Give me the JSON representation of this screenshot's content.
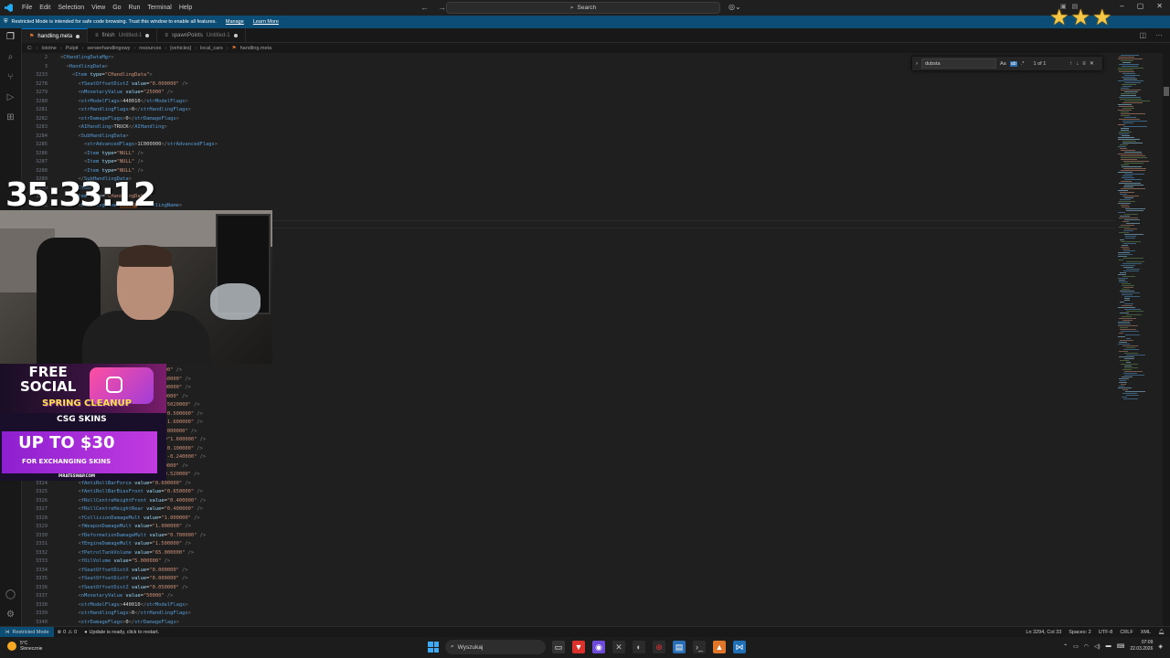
{
  "titlebar": {
    "menu": [
      "File",
      "Edit",
      "Selection",
      "View",
      "Go",
      "Run",
      "Terminal",
      "Help"
    ],
    "search_label": "Search"
  },
  "banner": {
    "message": "Restricted Mode is intended for safe code browsing. Trust this window to enable all features.",
    "manage": "Manage",
    "learn_more": "Learn More"
  },
  "tabs": [
    {
      "label": "handling.meta",
      "desc": "",
      "active": true,
      "dirty": true
    },
    {
      "label": "finish",
      "desc": "Untitled-1",
      "active": false,
      "dirty": true
    },
    {
      "label": "spawnPoints",
      "desc": "Untitled-1",
      "active": false,
      "dirty": true
    }
  ],
  "breadcrumb": [
    "C:",
    "Istotne",
    "Pulpit",
    "serwerhandlingowy",
    "resources",
    "[vehicles]",
    "local_cars",
    "handling.meta"
  ],
  "find": {
    "query": "dubsta",
    "match_case": "Aa",
    "whole_word": "ab",
    "regex": ".*",
    "match_count": "1 of 1"
  },
  "editor_lines": [
    {
      "n": "2",
      "t": "<CHandlingDataMgr>"
    },
    {
      "n": "3",
      "t": "  <HandlingData>"
    },
    {
      "n": "3233",
      "t": "    <Item type=\"CHandlingData\">"
    },
    {
      "n": "3278",
      "t": "      <fSeatOffsetDistZ value=\"0.000000\" />"
    },
    {
      "n": "3279",
      "t": "      <nMonetaryValue value=\"25000\" />"
    },
    {
      "n": "3280",
      "t": "      <strModelFlags>440010</strModelFlags>"
    },
    {
      "n": "3281",
      "t": "      <strHandlingFlags>0</strHandlingFlags>"
    },
    {
      "n": "3282",
      "t": "      <strDamageFlags>0</strDamageFlags>"
    },
    {
      "n": "3283",
      "t": "      <AIHandling>TRUCK</AIHandling>"
    },
    {
      "n": "3284",
      "t": "      <SubHandlingData>"
    },
    {
      "n": "3285",
      "t": "        <strAdvancedFlags>1C000000</strAdvancedFlags>"
    },
    {
      "n": "3286",
      "t": "        <Item type=\"NULL\" />"
    },
    {
      "n": "3287",
      "t": "        <Item type=\"NULL\" />"
    },
    {
      "n": "3288",
      "t": "        <Item type=\"NULL\" />"
    },
    {
      "n": "3289",
      "t": "      </SubHandlingData>"
    },
    {
      "n": "3290",
      "t": "    </Item>"
    },
    {
      "n": "3291",
      "t": "    <Item type=\"CHandlingData\">"
    },
    {
      "n": "3292",
      "t": "      <handlingName>DUBSTA</handlingName>"
    },
    {
      "n": "3293",
      "t": ""
    },
    {
      "n": "3294",
      "t": ""
    },
    {
      "n": "3295",
      "t": "      <fInitialDragCoeff value=\"8.150000\" />"
    },
    {
      "n": "3296",
      "t": "      <fPercentSubmerged value=\"85.000000\" />"
    },
    {
      "n": "3297",
      "t": ""
    },
    {
      "n": "3298",
      "t": ""
    },
    {
      "n": "3299",
      "t": ""
    },
    {
      "n": "3300",
      "t": ""
    },
    {
      "n": "3301",
      "t": ""
    },
    {
      "n": "3302",
      "t": ""
    },
    {
      "n": "3303",
      "t": ""
    },
    {
      "n": "3304",
      "t": ""
    },
    {
      "n": "3305",
      "t": ""
    },
    {
      "n": "3306",
      "t": ""
    },
    {
      "n": "3307",
      "t": ""
    },
    {
      "n": "3308",
      "t": ""
    },
    {
      "n": "3309",
      "t": ""
    },
    {
      "n": "3310",
      "t": ""
    },
    {
      "n": "3311",
      "t": "      <fSteeringLock value=\"25.500000\" />"
    },
    {
      "n": "3312",
      "t": "      <fTractionCurveMin value=\"0.150000\" />"
    },
    {
      "n": "3313",
      "t": "      <fTractionLossMult value=\"1.300000\" />"
    },
    {
      "n": "3314",
      "t": "      <fSuspensionForce value=\"0.000000\" />"
    },
    {
      "n": "3315",
      "t": "      <fSuspensionCompDamp value=\"0.5020000\" />"
    },
    {
      "n": "3316",
      "t": "      <fSuspensionUpperLimit value=\"0.500000\" />"
    },
    {
      "n": "3317",
      "t": "      <fSuspensionLowerLimit value=\"1.600000\" />"
    },
    {
      "n": "3318",
      "t": "      <fSuspensionCompDamp value=\"1.000000\" />"
    },
    {
      "n": "3319",
      "t": "      <fSuspensionReboundDamp value=\"1.600000\" />"
    },
    {
      "n": "3320",
      "t": "      <fSuspensionUpperLimit value=\"0.100000\" />"
    },
    {
      "n": "3321",
      "t": "      <fSuspensionLowerLimit value=\"-0.240000\" />"
    },
    {
      "n": "3322",
      "t": "      <fSuspensionRaise value=\"0.000000\" />"
    },
    {
      "n": "3323",
      "t": "      <fSuspensionBiasFront value=\"0.520000\" />"
    },
    {
      "n": "3324",
      "t": "      <fAntiRollBarForce value=\"0.600000\" />"
    },
    {
      "n": "3325",
      "t": "      <fAntiRollBarBiasFront value=\"0.650000\" />"
    },
    {
      "n": "3326",
      "t": "      <fRollCentreHeightFront value=\"0.400000\" />"
    },
    {
      "n": "3327",
      "t": "      <fRollCentreHeightRear value=\"0.400000\" />"
    },
    {
      "n": "3328",
      "t": "      <fCollisionDamageMult value=\"1.000000\" />"
    },
    {
      "n": "3329",
      "t": "      <fWeaponDamageMult value=\"1.000000\" />"
    },
    {
      "n": "3330",
      "t": "      <fDeformationDamageMult value=\"0.700000\" />"
    },
    {
      "n": "3331",
      "t": "      <fEngineDamageMult value=\"1.500000\" />"
    },
    {
      "n": "3332",
      "t": "      <fPetrolTankVolume value=\"65.000000\" />"
    },
    {
      "n": "3333",
      "t": "      <fOilVolume value=\"5.000000\" />"
    },
    {
      "n": "3334",
      "t": "      <fSeatOffsetDistX value=\"0.000000\" />"
    },
    {
      "n": "3335",
      "t": "      <fSeatOffsetDistY value=\"0.000000\" />"
    },
    {
      "n": "3336",
      "t": "      <fSeatOffsetDistZ value=\"0.050000\" />"
    },
    {
      "n": "3337",
      "t": "      <nMonetaryValue value=\"50000\" />"
    },
    {
      "n": "3338",
      "t": "      <strModelFlags>440010</strModelFlags>"
    },
    {
      "n": "3339",
      "t": "      <strHandlingFlags>0</strHandlingFlags>"
    },
    {
      "n": "3340",
      "t": "      <strDamageFlags>0</strDamageFlags>"
    }
  ],
  "statusbar": {
    "restricted": "Restricted Mode",
    "errors": "0",
    "warnings": "0",
    "update": "Update is ready, click to restart.",
    "position": "Ln 3294, Col 33",
    "spaces": "Spaces: 2",
    "encoding": "UTF-8",
    "eol": "CRLF",
    "language": "XML"
  },
  "taskbar": {
    "temp": "5°C",
    "weather": "Słonecznie",
    "search": "Wyszukaj",
    "time": "07:09",
    "date": "22.03.2026"
  },
  "overlay": {
    "timer": "35:33:12",
    "stars": 3,
    "promo_free": "FREE",
    "promo_social": "SOCIAL",
    "promo_spring": "SPRING CLEANUP",
    "promo_brand": "CSG SKINS",
    "promo_up": "UP TO $30",
    "promo_sub": "FOR EXCHANGING SKINS",
    "promo_url": "PIRATESWAP.COM"
  },
  "colors": {
    "accent": "#0078d4",
    "banner": "#0c4d75",
    "editor_bg": "#1f1f1f",
    "tag": "#569cd6",
    "attr": "#9cdcfe",
    "string": "#ce9178",
    "star": "#f6c744"
  }
}
